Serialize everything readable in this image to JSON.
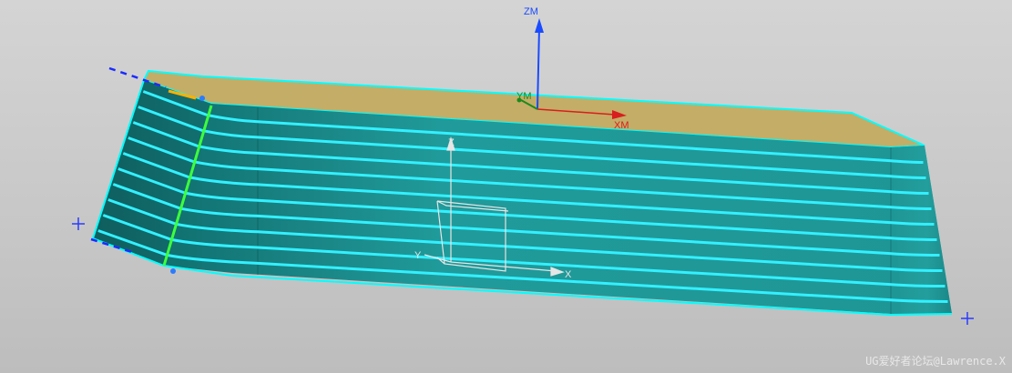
{
  "viewport": {
    "axis_labels": {
      "zm": "ZM",
      "xm": "XM",
      "ym": "YM",
      "z": "Z",
      "x": "X",
      "y": "Y"
    },
    "watermark": "UG爱好者论坛@Lawrence.X",
    "colors": {
      "background": "#c8c8c8",
      "top_face": "#c4ad66",
      "side_face": "#1f9494",
      "side_face_dark": "#116060",
      "toolpath": "#33f0ff",
      "edge_highlight": "#00ffff",
      "zm_axis": "#1a4bff",
      "xm_axis": "#d81e1e",
      "ym_axis": "#1c8a1c",
      "marker": "#2b3bff",
      "green_edge": "#3cff3c"
    },
    "icons": [
      "plus-marker-icon",
      "dashed-vector-icon",
      "wcs-triad-icon",
      "mcs-triad-icon"
    ]
  }
}
